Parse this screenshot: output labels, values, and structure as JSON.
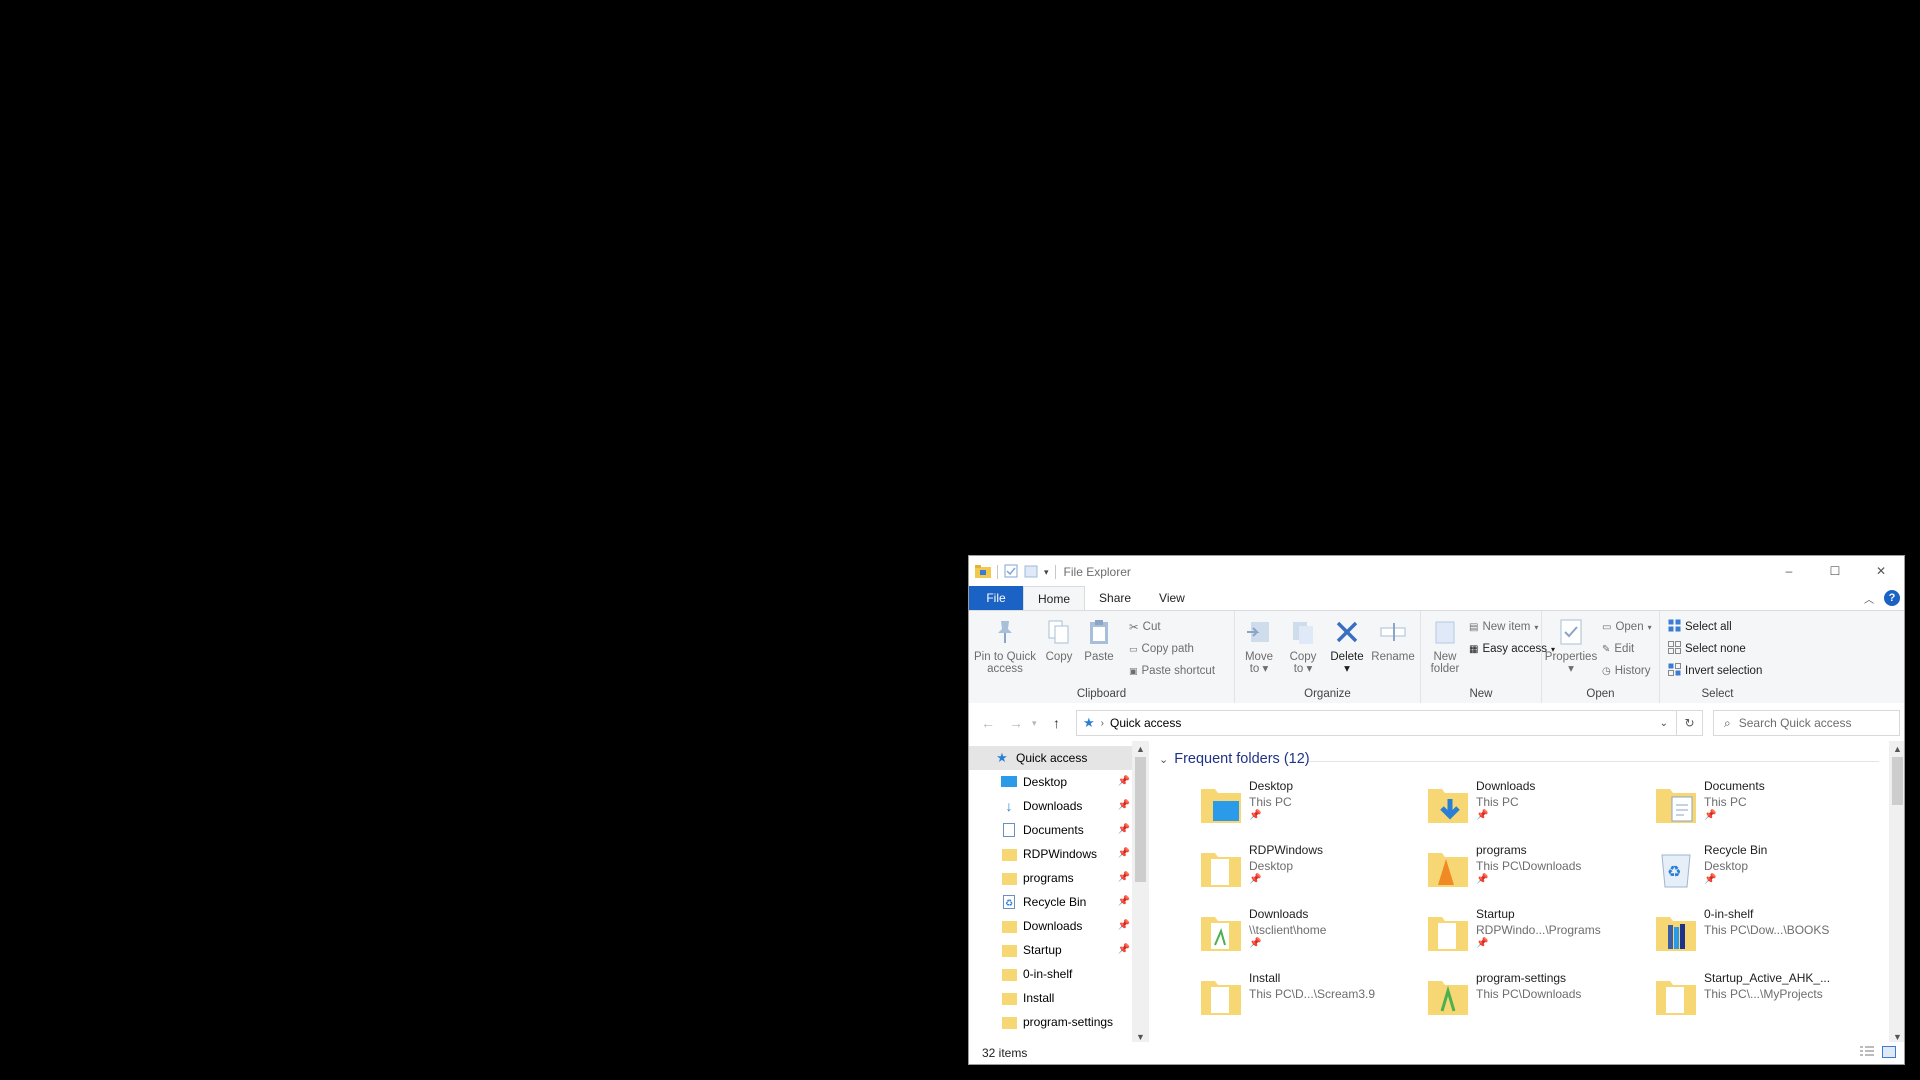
{
  "window": {
    "title": "File Explorer",
    "controls": {
      "minimize": "–",
      "maximize": "☐",
      "close": "✕"
    }
  },
  "ribbon_tabs": [
    {
      "label": "File"
    },
    {
      "label": "Home"
    },
    {
      "label": "Share"
    },
    {
      "label": "View"
    }
  ],
  "ribbon": {
    "clipboard": {
      "label": "Clipboard",
      "pin": "Pin to Quick access",
      "pin_l1": "Pin to Quick",
      "pin_l2": "access",
      "copy": "Copy",
      "paste": "Paste",
      "cut": "Cut",
      "copy_path": "Copy path",
      "paste_shortcut": "Paste shortcut"
    },
    "organize": {
      "label": "Organize",
      "move_l1": "Move",
      "move_l2": "to",
      "copy_l1": "Copy",
      "copy_l2": "to",
      "delete": "Delete",
      "rename": "Rename"
    },
    "new": {
      "label": "New",
      "folder_l1": "New",
      "folder_l2": "folder",
      "new_item": "New item",
      "easy_access": "Easy access"
    },
    "open": {
      "label": "Open",
      "properties": "Properties",
      "open": "Open",
      "edit": "Edit",
      "history": "History"
    },
    "select": {
      "label": "Select",
      "select_all": "Select all",
      "select_none": "Select none",
      "invert": "Invert selection"
    }
  },
  "address": {
    "path": "Quick access",
    "search_placeholder": "Search Quick access"
  },
  "nav": {
    "root": "Quick access",
    "items": [
      {
        "label": "Desktop",
        "pinned": true
      },
      {
        "label": "Downloads",
        "pinned": true
      },
      {
        "label": "Documents",
        "pinned": true
      },
      {
        "label": "RDPWindows",
        "pinned": true
      },
      {
        "label": "programs",
        "pinned": true
      },
      {
        "label": "Recycle Bin",
        "pinned": true
      },
      {
        "label": "Downloads",
        "pinned": true
      },
      {
        "label": "Startup",
        "pinned": true
      },
      {
        "label": "0-in-shelf",
        "pinned": false
      },
      {
        "label": "Install",
        "pinned": false
      },
      {
        "label": "program-settings",
        "pinned": false
      }
    ]
  },
  "content": {
    "section": "Frequent folders (12)",
    "tiles": [
      {
        "name": "Desktop",
        "path": "This PC"
      },
      {
        "name": "Downloads",
        "path": "This PC"
      },
      {
        "name": "Documents",
        "path": "This PC"
      },
      {
        "name": "RDPWindows",
        "path": "Desktop"
      },
      {
        "name": "programs",
        "path": "This PC\\Downloads"
      },
      {
        "name": "Recycle Bin",
        "path": "Desktop"
      },
      {
        "name": "Downloads",
        "path": "\\\\tsclient\\home"
      },
      {
        "name": "Startup",
        "path": "RDPWindo...\\Programs"
      },
      {
        "name": "0-in-shelf",
        "path": "This PC\\Dow...\\BOOKS"
      },
      {
        "name": "Install",
        "path": "This PC\\D...\\Scream3.9"
      },
      {
        "name": "program-settings",
        "path": "This PC\\Downloads"
      },
      {
        "name": "Startup_Active_AHK_...",
        "path": "This PC\\...\\MyProjects"
      }
    ]
  },
  "status": {
    "count": "32 items"
  },
  "colors": {
    "accent": "#1a62c3",
    "folder": "#f7d774",
    "section_header": "#1e3287"
  }
}
